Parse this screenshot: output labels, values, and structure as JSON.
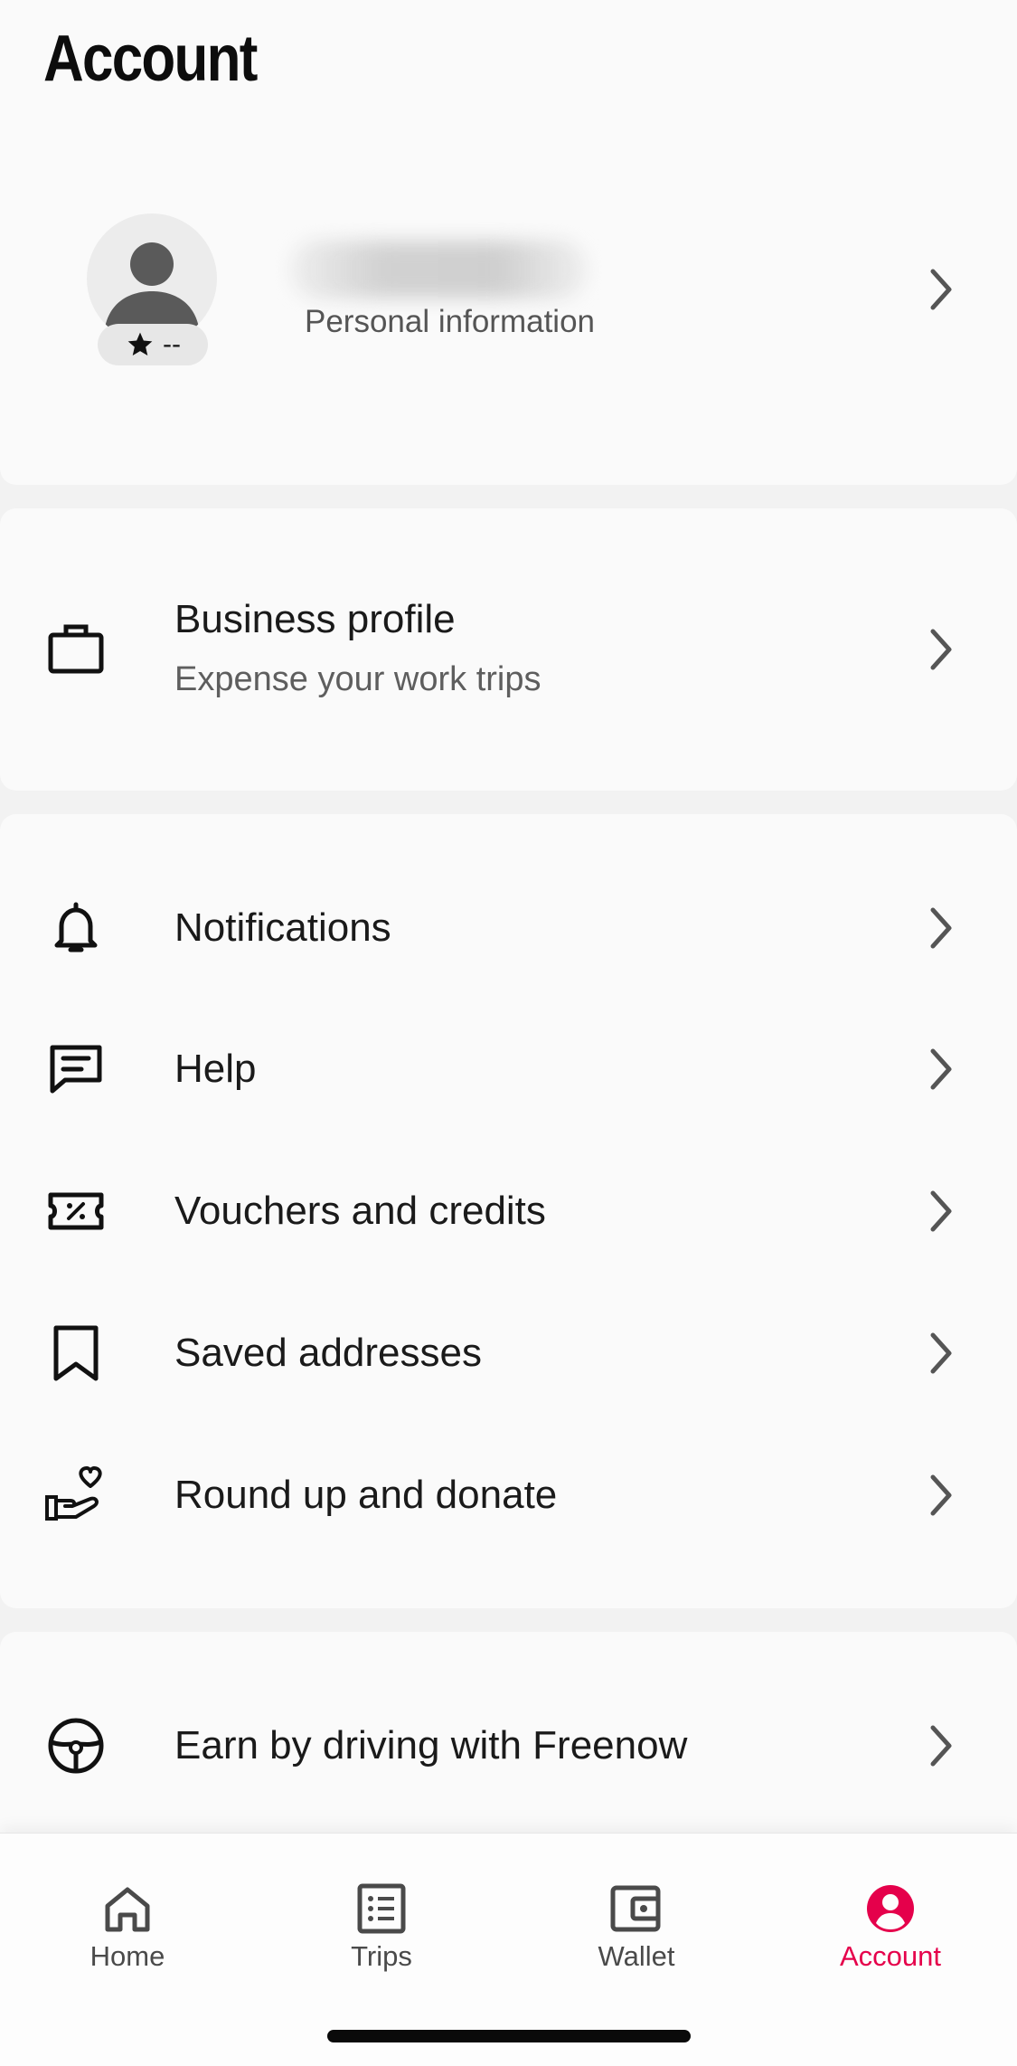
{
  "header": {
    "title": "Account"
  },
  "profile": {
    "subtitle": "Personal information",
    "rating": "--",
    "icons": {
      "avatar": "user-silhouette",
      "rating": "star-icon",
      "chevron": "chevron-right-icon"
    }
  },
  "business": {
    "title": "Business profile",
    "subtitle": "Expense your work trips",
    "icon": "briefcase-icon"
  },
  "menu": {
    "items": [
      {
        "label": "Notifications",
        "icon": "bell-icon"
      },
      {
        "label": "Help",
        "icon": "chat-icon"
      },
      {
        "label": "Vouchers and credits",
        "icon": "voucher-icon"
      },
      {
        "label": "Saved addresses",
        "icon": "bookmark-icon"
      },
      {
        "label": "Round up and donate",
        "icon": "donate-hand-heart-icon"
      }
    ]
  },
  "driver": {
    "label": "Earn by driving with Freenow",
    "icon": "steering-wheel-icon"
  },
  "nav": {
    "items": [
      {
        "label": "Home",
        "icon": "home-icon",
        "active": false
      },
      {
        "label": "Trips",
        "icon": "list-icon",
        "active": false
      },
      {
        "label": "Wallet",
        "icon": "wallet-icon",
        "active": false
      },
      {
        "label": "Account",
        "icon": "account-icon",
        "active": true
      }
    ]
  },
  "colors": {
    "accent": "#e5004b",
    "background": "#f2f2f2",
    "card": "#fafafa"
  }
}
